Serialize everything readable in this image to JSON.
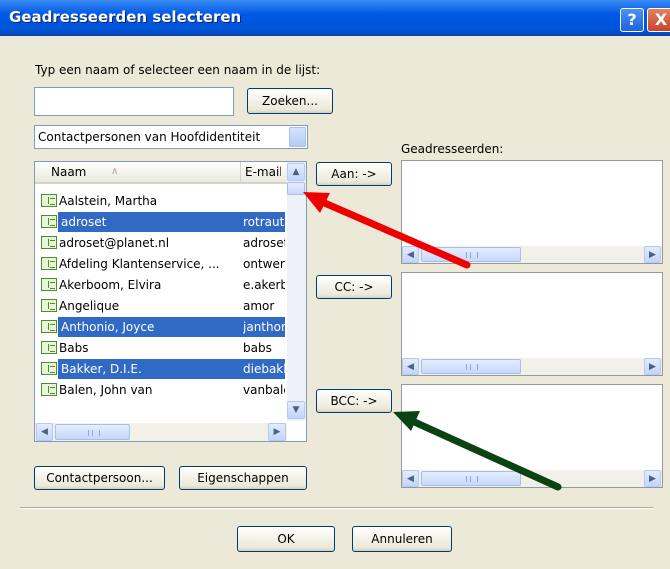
{
  "window": {
    "title": "Geadresseerden selecteren"
  },
  "titlebar": {
    "help_glyph": "?",
    "close_glyph": "X"
  },
  "search": {
    "label": "Typ een naam of selecteer een naam in de lijst:",
    "value": "",
    "button": "Zoeken..."
  },
  "addressbook": {
    "selected": "Contactpersonen van Hoofdidentiteit"
  },
  "recipients_label": "Geadresseerden:",
  "list": {
    "columns": [
      "Naam",
      "E-mail"
    ],
    "sort_glyph": "∧",
    "rows": [
      {
        "name": "Aalstein, Martha",
        "email": "",
        "selected": false
      },
      {
        "name": "adroset",
        "email": "rotraut",
        "selected": true
      },
      {
        "name": "adroset@planet.nl",
        "email": "adroset",
        "selected": false
      },
      {
        "name": "Afdeling Klantenservice, ...",
        "email": "ontwerp",
        "selected": false
      },
      {
        "name": "Akerboom, Elvira",
        "email": "e.akerb",
        "selected": false
      },
      {
        "name": "Angelique",
        "email": "amor",
        "selected": false
      },
      {
        "name": "Anthonio, Joyce",
        "email": "janthonio",
        "selected": true
      },
      {
        "name": "Babs",
        "email": "babs",
        "selected": false
      },
      {
        "name": "Bakker, D.I.E.",
        "email": "diebakker",
        "selected": true
      },
      {
        "name": "Balen, John van",
        "email": "vanbalen",
        "selected": false
      }
    ]
  },
  "buttons": {
    "to": "Aan: ->",
    "cc": "CC: ->",
    "bcc": "BCC: ->",
    "contact": "Contactpersoon...",
    "properties": "Eigenschappen",
    "ok": "OK",
    "cancel": "Annuleren"
  },
  "scroll_glyphs": {
    "up": "▲",
    "down": "▼",
    "left": "◀",
    "right": "▶"
  },
  "colors": {
    "titlebar": "#0058e6",
    "selection": "#316ac5",
    "red_arrow": "#ee0000",
    "green_arrow": "#0b4412",
    "dialog": "#ece9d8"
  }
}
